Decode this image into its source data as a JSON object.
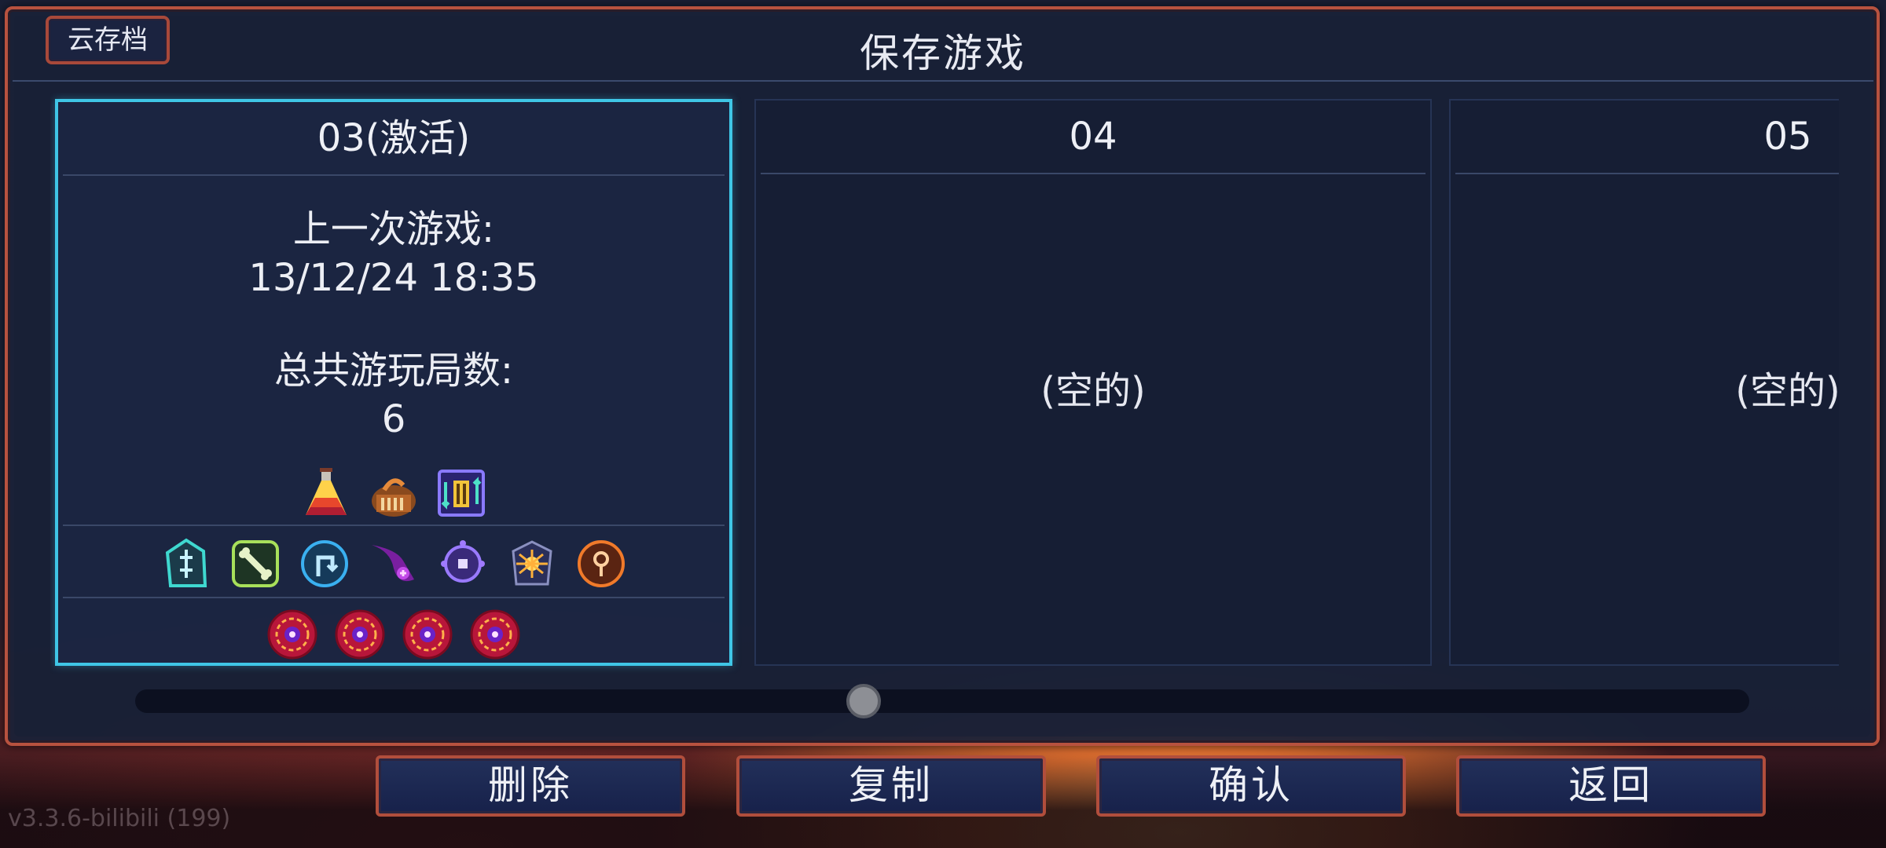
{
  "title": "保存游戏",
  "cloud_save_label": "云存档",
  "slots": [
    {
      "name": "03(激活)",
      "last_played_label": "上一次游戏:",
      "last_played_value": "13/12/24  18:35",
      "total_runs_label": "总共游玩局数:",
      "total_runs_value": "6",
      "item_icons": [
        "flask-icon",
        "treasure-chest-icon",
        "scroll-upgrade-icon"
      ],
      "mutation_icons": [
        "teal-rune-icon",
        "bone-icon",
        "teleport-rune-icon",
        "purple-tentacle-icon",
        "eye-orb-icon",
        "spider-icon",
        "orange-rune-icon"
      ],
      "boss_cell_icons": [
        "boss-cell-icon",
        "boss-cell-icon",
        "boss-cell-icon",
        "boss-cell-icon"
      ]
    },
    {
      "name": "04",
      "empty_label": "(空的)"
    },
    {
      "name": "05",
      "empty_label": "(空的)"
    }
  ],
  "buttons": {
    "delete": "删除",
    "copy": "复制",
    "confirm": "确认",
    "back": "返回"
  },
  "scroll_position": 0.45,
  "version": "v3.3.6-bilibili (199)",
  "colors": {
    "active_border": "#3fc6e6",
    "frame_border": "#b8523f",
    "panel_bg": "#1a2138"
  }
}
